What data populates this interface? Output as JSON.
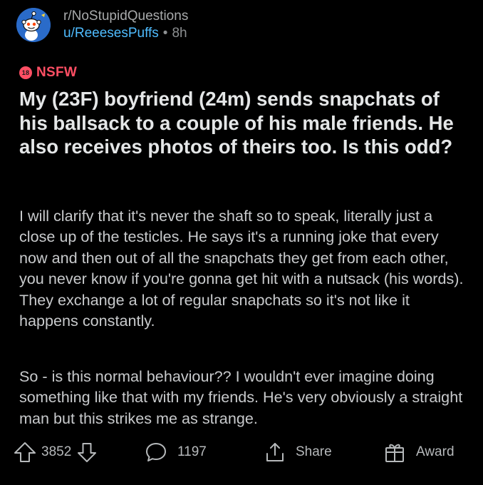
{
  "post": {
    "subreddit": "r/NoStupidQuestions",
    "username": "u/ReeesesPuffs",
    "separator": "•",
    "age": "8h",
    "nsfw_badge": "18",
    "nsfw_label": "NSFW",
    "title": "My (23F) boyfriend (24m) sends snapchats of his ballsack to a couple of his male friends. He also receives photos of theirs too. Is this odd?",
    "paragraphs": [
      "I will clarify that it's never the shaft so to speak, literally just a close up of the testicles. He says it's a running joke that every now and then out of all the snapchats they get from each other, you never know if you're gonna get hit with a nutsack (his words). They exchange a lot of regular snapchats so it's not like it happens constantly.",
      "So - is this normal behaviour?? I wouldn't ever imagine doing something like that with my friends. He's very obviously a straight man but this strikes me as strange."
    ]
  },
  "actions": {
    "upvotes": "3852",
    "comments": "1197",
    "share_label": "Share",
    "award_label": "Award"
  },
  "icons": {
    "avatar": "snoo-avatar-icon",
    "upvote": "arrow-up-icon",
    "downvote": "arrow-down-icon",
    "comment": "comment-bubble-icon",
    "share": "share-icon",
    "award": "gift-icon"
  },
  "colors": {
    "background": "#000000",
    "username": "#4fbcff",
    "nsfw": "#ff4f64",
    "avatar_bg": "#2a6bc9"
  }
}
